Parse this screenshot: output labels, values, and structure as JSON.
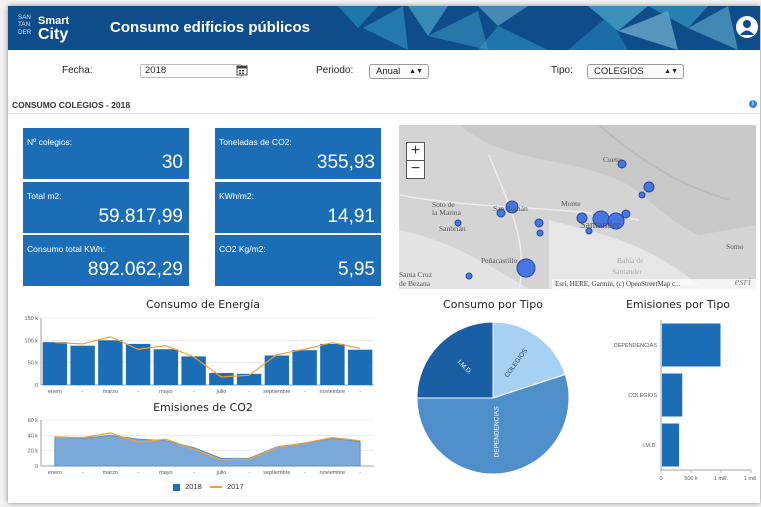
{
  "header": {
    "logo_small_1": "SAN",
    "logo_small_2": "TAN",
    "logo_small_3": "DER",
    "logo_word_1": "Smart",
    "logo_word_2": "City",
    "title": "Consumo edificios públicos",
    "user_icon": "user-icon"
  },
  "filters": {
    "fecha_label": "Fecha:",
    "fecha_value": "2018",
    "calendar_icon": "calendar-icon",
    "periodo_label": "Periodo:",
    "periodo_value": "Anual",
    "tipo_label": "Tipo:",
    "tipo_value": "COLEGIOS"
  },
  "section": {
    "title": "CONSUMO COLEGIOS - 2018",
    "info_icon": "info-icon"
  },
  "kpis": [
    {
      "label": "Nº colegios:",
      "value": "30"
    },
    {
      "label": "Toneladas de CO2:",
      "value": "355,93"
    },
    {
      "label": "Total m2:",
      "value": "59.817,99"
    },
    {
      "label": "KWh/m2:",
      "value": "14,91"
    },
    {
      "label": "Consumo total KWh:",
      "value": "892.062,29"
    },
    {
      "label": "CO2 Kg/m2:",
      "value": "5,95"
    }
  ],
  "map": {
    "zoom_in": "+",
    "zoom_out": "−",
    "attribution": "Esri, HERE, Garmin, (c) OpenStreetMap c...",
    "esri_logo": "esri",
    "labels": [
      "Cueto",
      "Soto de",
      "la Marina",
      "Monte",
      "Sanbrián",
      "Peñacastillo",
      "Santa Cruz",
      "de Bezana",
      "Bahía de",
      "Santander",
      "Somo",
      "San Román",
      "Santander"
    ]
  },
  "colors": {
    "primary": "#1b6db5",
    "header": "#0f4c8a",
    "line_2017": "#f0a030",
    "area": "#7aa8d8"
  },
  "chart_data": [
    {
      "type": "bar",
      "title": "Consumo de Energía",
      "categories": [
        "enero",
        "febrero",
        "marzo",
        "abril",
        "mayo",
        "junio",
        "julio",
        "agosto",
        "septiembre",
        "octubre",
        "noviembre",
        "diciembre"
      ],
      "tick_labels": [
        "enero",
        "-",
        "marzo",
        "-",
        "mayo",
        "-",
        "julio",
        "-",
        "septiembre",
        "-",
        "noviembre",
        "-"
      ],
      "y_ticks": [
        "0",
        "50 k",
        "100 k",
        "150 k"
      ],
      "ylim": [
        0,
        150000
      ],
      "series": [
        {
          "name": "2018",
          "type": "bar",
          "values": [
            96000,
            88000,
            100000,
            92000,
            80000,
            64000,
            27000,
            25000,
            66000,
            78000,
            92000,
            79000
          ]
        },
        {
          "name": "2017",
          "type": "line",
          "values": [
            95000,
            92000,
            108000,
            80000,
            88000,
            63000,
            18000,
            22000,
            68000,
            80000,
            95000,
            82000
          ]
        }
      ]
    },
    {
      "type": "area",
      "title": "Emisiones de CO2",
      "categories": [
        "enero",
        "febrero",
        "marzo",
        "abril",
        "mayo",
        "junio",
        "julio",
        "agosto",
        "septiembre",
        "octubre",
        "noviembre",
        "diciembre"
      ],
      "tick_labels": [
        "enero",
        "-",
        "marzo",
        "-",
        "mayo",
        "-",
        "julio",
        "-",
        "septiembre",
        "-",
        "noviembre",
        "-"
      ],
      "y_ticks": [
        "0",
        "20 k",
        "40 k",
        "60 k"
      ],
      "ylim": [
        0,
        60000
      ],
      "series": [
        {
          "name": "2018",
          "type": "area",
          "values": [
            38000,
            36000,
            40000,
            35000,
            33000,
            24000,
            10000,
            10000,
            25000,
            30000,
            36000,
            32000
          ]
        },
        {
          "name": "2017",
          "type": "line",
          "values": [
            38000,
            37000,
            43000,
            31000,
            35000,
            22000,
            8000,
            9000,
            24000,
            30000,
            37000,
            33000
          ]
        }
      ]
    },
    {
      "type": "pie",
      "title": "Consumo por Tipo",
      "categories": [
        "COLEGIOS",
        "DEPENDENCIAS",
        "I.M.D."
      ],
      "values": [
        20,
        55,
        25
      ]
    },
    {
      "type": "bar",
      "orientation": "horizontal",
      "title": "Emisiones por Tipo",
      "categories": [
        "DEPENDENCIAS",
        "COLEGIOS",
        "I.M.D."
      ],
      "values": [
        1300000,
        450000,
        380000
      ],
      "x_ticks": [
        "0",
        "500 k",
        "1 mill.",
        "1 mill."
      ],
      "xlim": [
        0,
        2000000
      ]
    }
  ],
  "legend": {
    "items": [
      "2018",
      "2017"
    ]
  }
}
